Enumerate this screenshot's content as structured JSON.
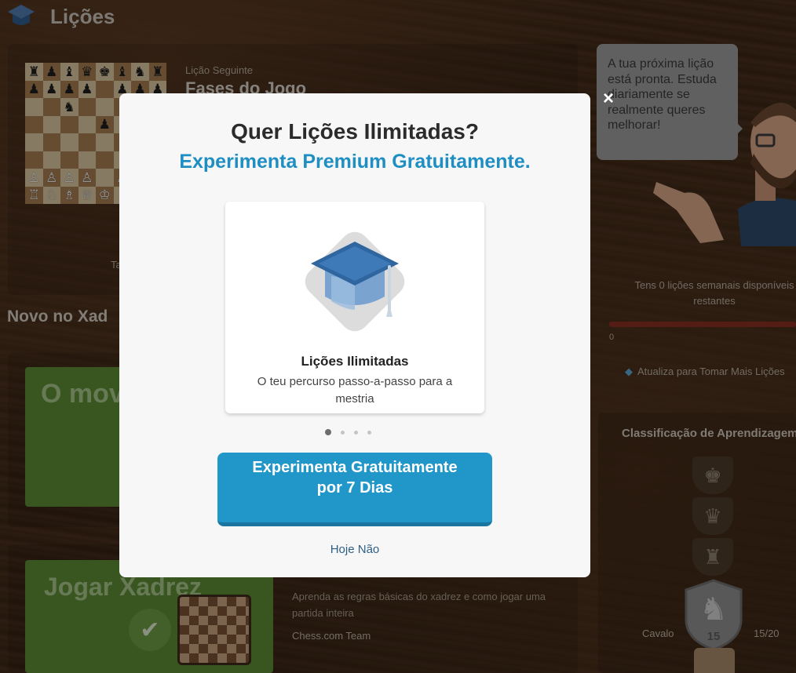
{
  "header": {
    "title": "Lições"
  },
  "next_lesson": {
    "label": "Lição Seguinte",
    "title": "Fases do Jogo",
    "cut_text": "Ta"
  },
  "board": {
    "rows": [
      [
        "♜",
        "♟",
        "♝",
        "♛",
        "♚",
        "♝",
        "♞",
        "♜"
      ],
      [
        "♟",
        "♟",
        "♟",
        "♟",
        "",
        "♟",
        "♟",
        "♟"
      ],
      [
        "",
        "",
        "♞",
        "",
        "",
        "",
        "",
        ""
      ],
      [
        "",
        "",
        "",
        "",
        "♟",
        "",
        "",
        ""
      ],
      [
        "",
        "",
        "",
        "",
        "",
        "",
        "",
        ""
      ],
      [
        "",
        "",
        "",
        "",
        "",
        "",
        "",
        ""
      ],
      [
        "♙",
        "♙",
        "♙",
        "♙",
        "",
        "♙",
        "♙",
        "♙"
      ],
      [
        "♖",
        "♘",
        "♗",
        "♕",
        "♔",
        "♗",
        "♘",
        "♖"
      ]
    ]
  },
  "section": {
    "title": "Novo no Xad"
  },
  "lesson1": {
    "title": "O mov das pe"
  },
  "lesson2": {
    "title": "Jogar Xadrez",
    "description": "Aprenda as regras básicas do xadrez e como jogar uma partida inteira",
    "author": "Chess.com Team"
  },
  "coach": {
    "speech": "A tua próxima lição está pronta. Estuda diariamente se realmente queres melhorar!"
  },
  "weekly": {
    "text": "Tens 0 lições semanais disponíveis restantes",
    "count": "0",
    "upgrade": "Atualiza para Tomar Mais Lições"
  },
  "ranking": {
    "title": "Classificação de Aprendizagem",
    "rank_name": "Cavalo",
    "progress": "15/20",
    "badge_number": "15"
  },
  "modal": {
    "close_symbol": "×",
    "title": "Quer Lições Ilimitadas?",
    "subtitle": "Experimenta Premium Gratuitamente.",
    "feature_title": "Lições Ilimitadas",
    "feature_desc": "O teu percurso passo-a-passo para a mestria",
    "cta": "Experimenta Gratuitamente por 7 Dias",
    "dismiss": "Hoje Não",
    "carousel_active": 1,
    "carousel_total": 4
  },
  "colors": {
    "accent": "#2196c9",
    "subtitle": "#1f8ec3",
    "link": "#2e5f85",
    "green": "#5c8c36"
  },
  "icons": {
    "logo": "graduation-cap-icon",
    "feature": "graduation-cap-icon",
    "close": "close-icon",
    "check": "check-icon",
    "gem": "diamond-icon"
  }
}
